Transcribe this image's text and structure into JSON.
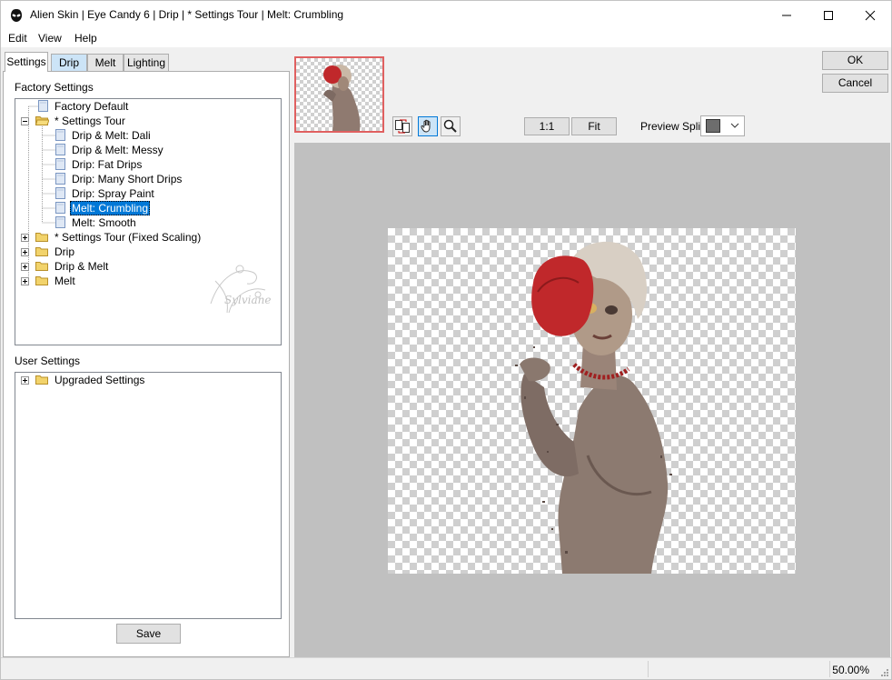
{
  "window": {
    "title": "Alien Skin | Eye Candy 6 | Drip | * Settings Tour | Melt: Crumbling",
    "app_icon": "alien-skin-logo-icon",
    "controls": [
      "minimize-icon",
      "maximize-icon",
      "close-icon"
    ]
  },
  "menu": {
    "items": [
      {
        "label": "Edit"
      },
      {
        "label": "View"
      },
      {
        "label": "Help"
      }
    ]
  },
  "tabs": [
    {
      "label": "Settings",
      "active": true
    },
    {
      "label": "Drip",
      "active": false
    },
    {
      "label": "Melt",
      "active": false
    },
    {
      "label": "Lighting",
      "active": false
    }
  ],
  "factory_settings": {
    "label": "Factory Settings",
    "tree": [
      {
        "label": "Factory Default",
        "type": "file",
        "level": 0
      },
      {
        "label": "* Settings Tour",
        "type": "folder",
        "level": 0,
        "expanded": true
      },
      {
        "label": "Drip & Melt: Dali",
        "type": "file",
        "level": 1
      },
      {
        "label": "Drip & Melt: Messy",
        "type": "file",
        "level": 1
      },
      {
        "label": "Drip: Fat Drips",
        "type": "file",
        "level": 1
      },
      {
        "label": "Drip: Many Short Drips",
        "type": "file",
        "level": 1
      },
      {
        "label": "Drip: Spray Paint",
        "type": "file",
        "level": 1
      },
      {
        "label": "Melt: Crumbling",
        "type": "file",
        "level": 1,
        "selected": true
      },
      {
        "label": "Melt: Smooth",
        "type": "file",
        "level": 1
      },
      {
        "label": "* Settings Tour (Fixed Scaling)",
        "type": "folder",
        "level": 0,
        "expanded": false
      },
      {
        "label": "Drip",
        "type": "folder",
        "level": 0,
        "expanded": false
      },
      {
        "label": "Drip & Melt",
        "type": "folder",
        "level": 0,
        "expanded": false
      },
      {
        "label": "Melt",
        "type": "folder",
        "level": 0,
        "expanded": false
      }
    ],
    "watermark": "Sylviane"
  },
  "user_settings": {
    "label": "User Settings",
    "tree": [
      {
        "label": "Upgraded Settings",
        "type": "folder",
        "level": 0,
        "expanded": false
      }
    ]
  },
  "save_button": {
    "label": "Save"
  },
  "toolbar": {
    "tools": [
      "swap-preview-icon",
      "hand-pan-icon",
      "zoom-magnifier-icon"
    ],
    "zoom_1_1_label": "1:1",
    "fit_label": "Fit",
    "preview_split_label": "Preview Split:",
    "preview_split_color": "#6d6d6d"
  },
  "dialog_buttons": {
    "ok": "OK",
    "cancel": "Cancel"
  },
  "status": {
    "zoom": "50.00%"
  },
  "colors": {
    "selection": "#0078d7",
    "thumbnail_border": "#e06060",
    "preview_background": "#c0c0c0",
    "hair_red": "#c0282b"
  }
}
